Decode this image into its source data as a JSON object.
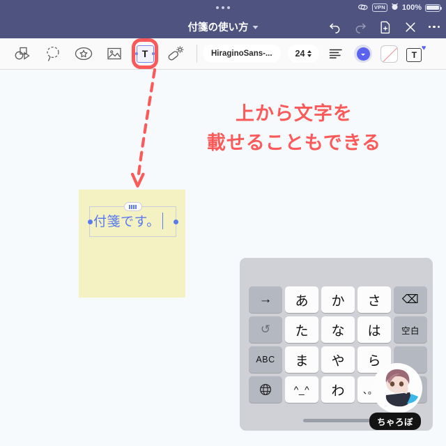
{
  "status_bar": {
    "link_icon": "link-icon",
    "vpn_label": "VPN",
    "alarm_icon": "alarm-clock-icon",
    "battery_percent": "100%",
    "battery_icon": "battery-full-icon",
    "grabber_icon": "window-grabber-dots"
  },
  "header": {
    "title": "付箋の使い方",
    "title_chevron": "chevron-down-icon",
    "actions": [
      {
        "name": "undo-button",
        "icon": "undo-arrow-icon",
        "enabled": true
      },
      {
        "name": "redo-button",
        "icon": "redo-arrow-icon",
        "enabled": false
      },
      {
        "name": "new-page-button",
        "icon": "document-plus-icon",
        "enabled": true
      },
      {
        "name": "close-button",
        "icon": "close-x-icon",
        "enabled": true
      },
      {
        "name": "more-button",
        "icon": "more-horizontal-icon",
        "enabled": true
      }
    ]
  },
  "toolbar": {
    "tools": [
      {
        "name": "pen-tool",
        "icon": "pen-icon"
      },
      {
        "name": "shapes-tool",
        "icon": "shapes-icon"
      },
      {
        "name": "lasso-tool",
        "icon": "lasso-dashed-circle-icon"
      },
      {
        "name": "sticker-tool",
        "icon": "star-sticker-icon"
      },
      {
        "name": "image-tool",
        "icon": "image-icon"
      },
      {
        "name": "text-tool",
        "icon": "text-T-icon",
        "label": "T",
        "active": true,
        "highlighted": true
      },
      {
        "name": "eraser-tool",
        "icon": "magic-eraser-icon"
      }
    ],
    "font_name": "HiraginoSans-...",
    "font_size": "24",
    "stepper_icon": "stepper-up-down-icon",
    "align_icon": "align-left-icon",
    "text_color": "#5a63f0",
    "color_picker_icon": "color-circle-icon",
    "fill_none_icon": "no-fill-swatch-icon",
    "text_style_icon": "text-style-heart-icon",
    "text_style_label": "T",
    "heart_glyph": "♥"
  },
  "canvas": {
    "background": "#f7fafc",
    "annotation": {
      "line1": "上から文字を",
      "line2": "載せることもできる",
      "color": "#fb5a5a"
    },
    "arrow": {
      "name": "dashed-arrow",
      "color": "#fb5a5a",
      "style": "dashed-curved-down"
    },
    "sticky_note": {
      "color": "#f4f2c2",
      "text": "付箋です。",
      "text_color": "#5a7bf0",
      "selected": true,
      "caret_visible": true,
      "grip_icon": "drag-grip-icon",
      "handle_left_icon": "resize-handle-icon",
      "handle_right_icon": "resize-handle-icon"
    }
  },
  "keyboard": {
    "type": "japanese-flick-keypad",
    "keys": [
      {
        "label": "→",
        "name": "key-cursor-right",
        "kind": "fn"
      },
      {
        "label": "あ",
        "name": "key-a",
        "kind": "char"
      },
      {
        "label": "か",
        "name": "key-ka",
        "kind": "char"
      },
      {
        "label": "さ",
        "name": "key-sa",
        "kind": "char"
      },
      {
        "label": "⌫",
        "name": "key-backspace",
        "kind": "fn"
      },
      {
        "label": "↺",
        "name": "key-undo",
        "kind": "fn"
      },
      {
        "label": "た",
        "name": "key-ta",
        "kind": "char"
      },
      {
        "label": "な",
        "name": "key-na",
        "kind": "char"
      },
      {
        "label": "は",
        "name": "key-ha",
        "kind": "char"
      },
      {
        "label": "空白",
        "name": "key-space",
        "kind": "fn-small"
      },
      {
        "label": "ABC",
        "name": "key-abc",
        "kind": "fn-small"
      },
      {
        "label": "ま",
        "name": "key-ma",
        "kind": "char"
      },
      {
        "label": "や",
        "name": "key-ya",
        "kind": "char"
      },
      {
        "label": "ら",
        "name": "key-ra",
        "kind": "char"
      },
      {
        "label": "",
        "name": "key-return",
        "kind": "blank"
      },
      {
        "label": "⊕",
        "name": "key-globe",
        "kind": "fn"
      },
      {
        "label": "^_^",
        "name": "key-emoticon",
        "kind": "char-small"
      },
      {
        "label": "わ",
        "name": "key-wa",
        "kind": "char"
      },
      {
        "label": "、。?!",
        "name": "key-punctuation",
        "kind": "char-small"
      },
      {
        "label": "",
        "name": "key-return-lower",
        "kind": "blank"
      }
    ],
    "home_indicator": "home-indicator"
  },
  "watermark": {
    "avatar_icon": "character-avatar",
    "label": "ちゃろぼ"
  }
}
